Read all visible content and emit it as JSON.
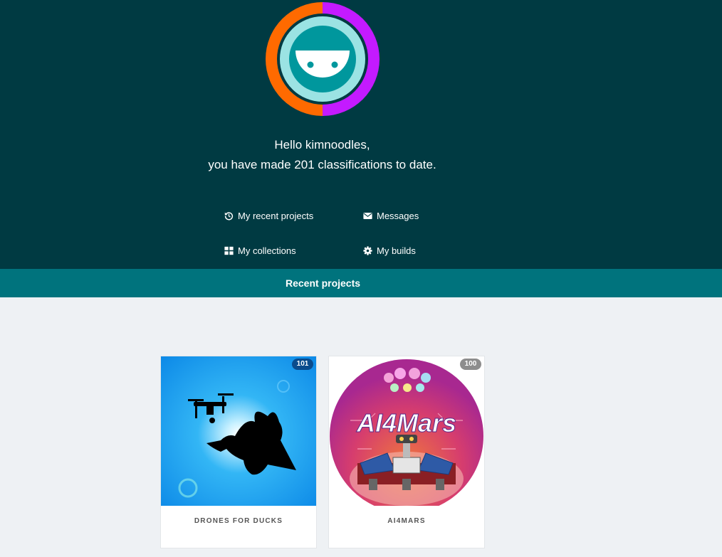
{
  "greeting": {
    "line1": "Hello kimnoodles,",
    "line2": "you have made 201 classifications to date."
  },
  "nav": {
    "recent_projects": "My recent projects",
    "messages": "Messages",
    "collections": "My collections",
    "builds": "My builds"
  },
  "tabs": {
    "active": "Recent projects"
  },
  "projects": [
    {
      "title": "DRONES FOR DUCKS",
      "count": "101",
      "badge_color": "#0a4b8c"
    },
    {
      "title": "AI4MARS",
      "count": "100",
      "badge_color": "#8d8d8d"
    }
  ],
  "colors": {
    "hero_bg": "#003a42",
    "tab_bar": "#00737d",
    "avatar_orange": "#ff6a00",
    "avatar_purple": "#c41aff"
  }
}
